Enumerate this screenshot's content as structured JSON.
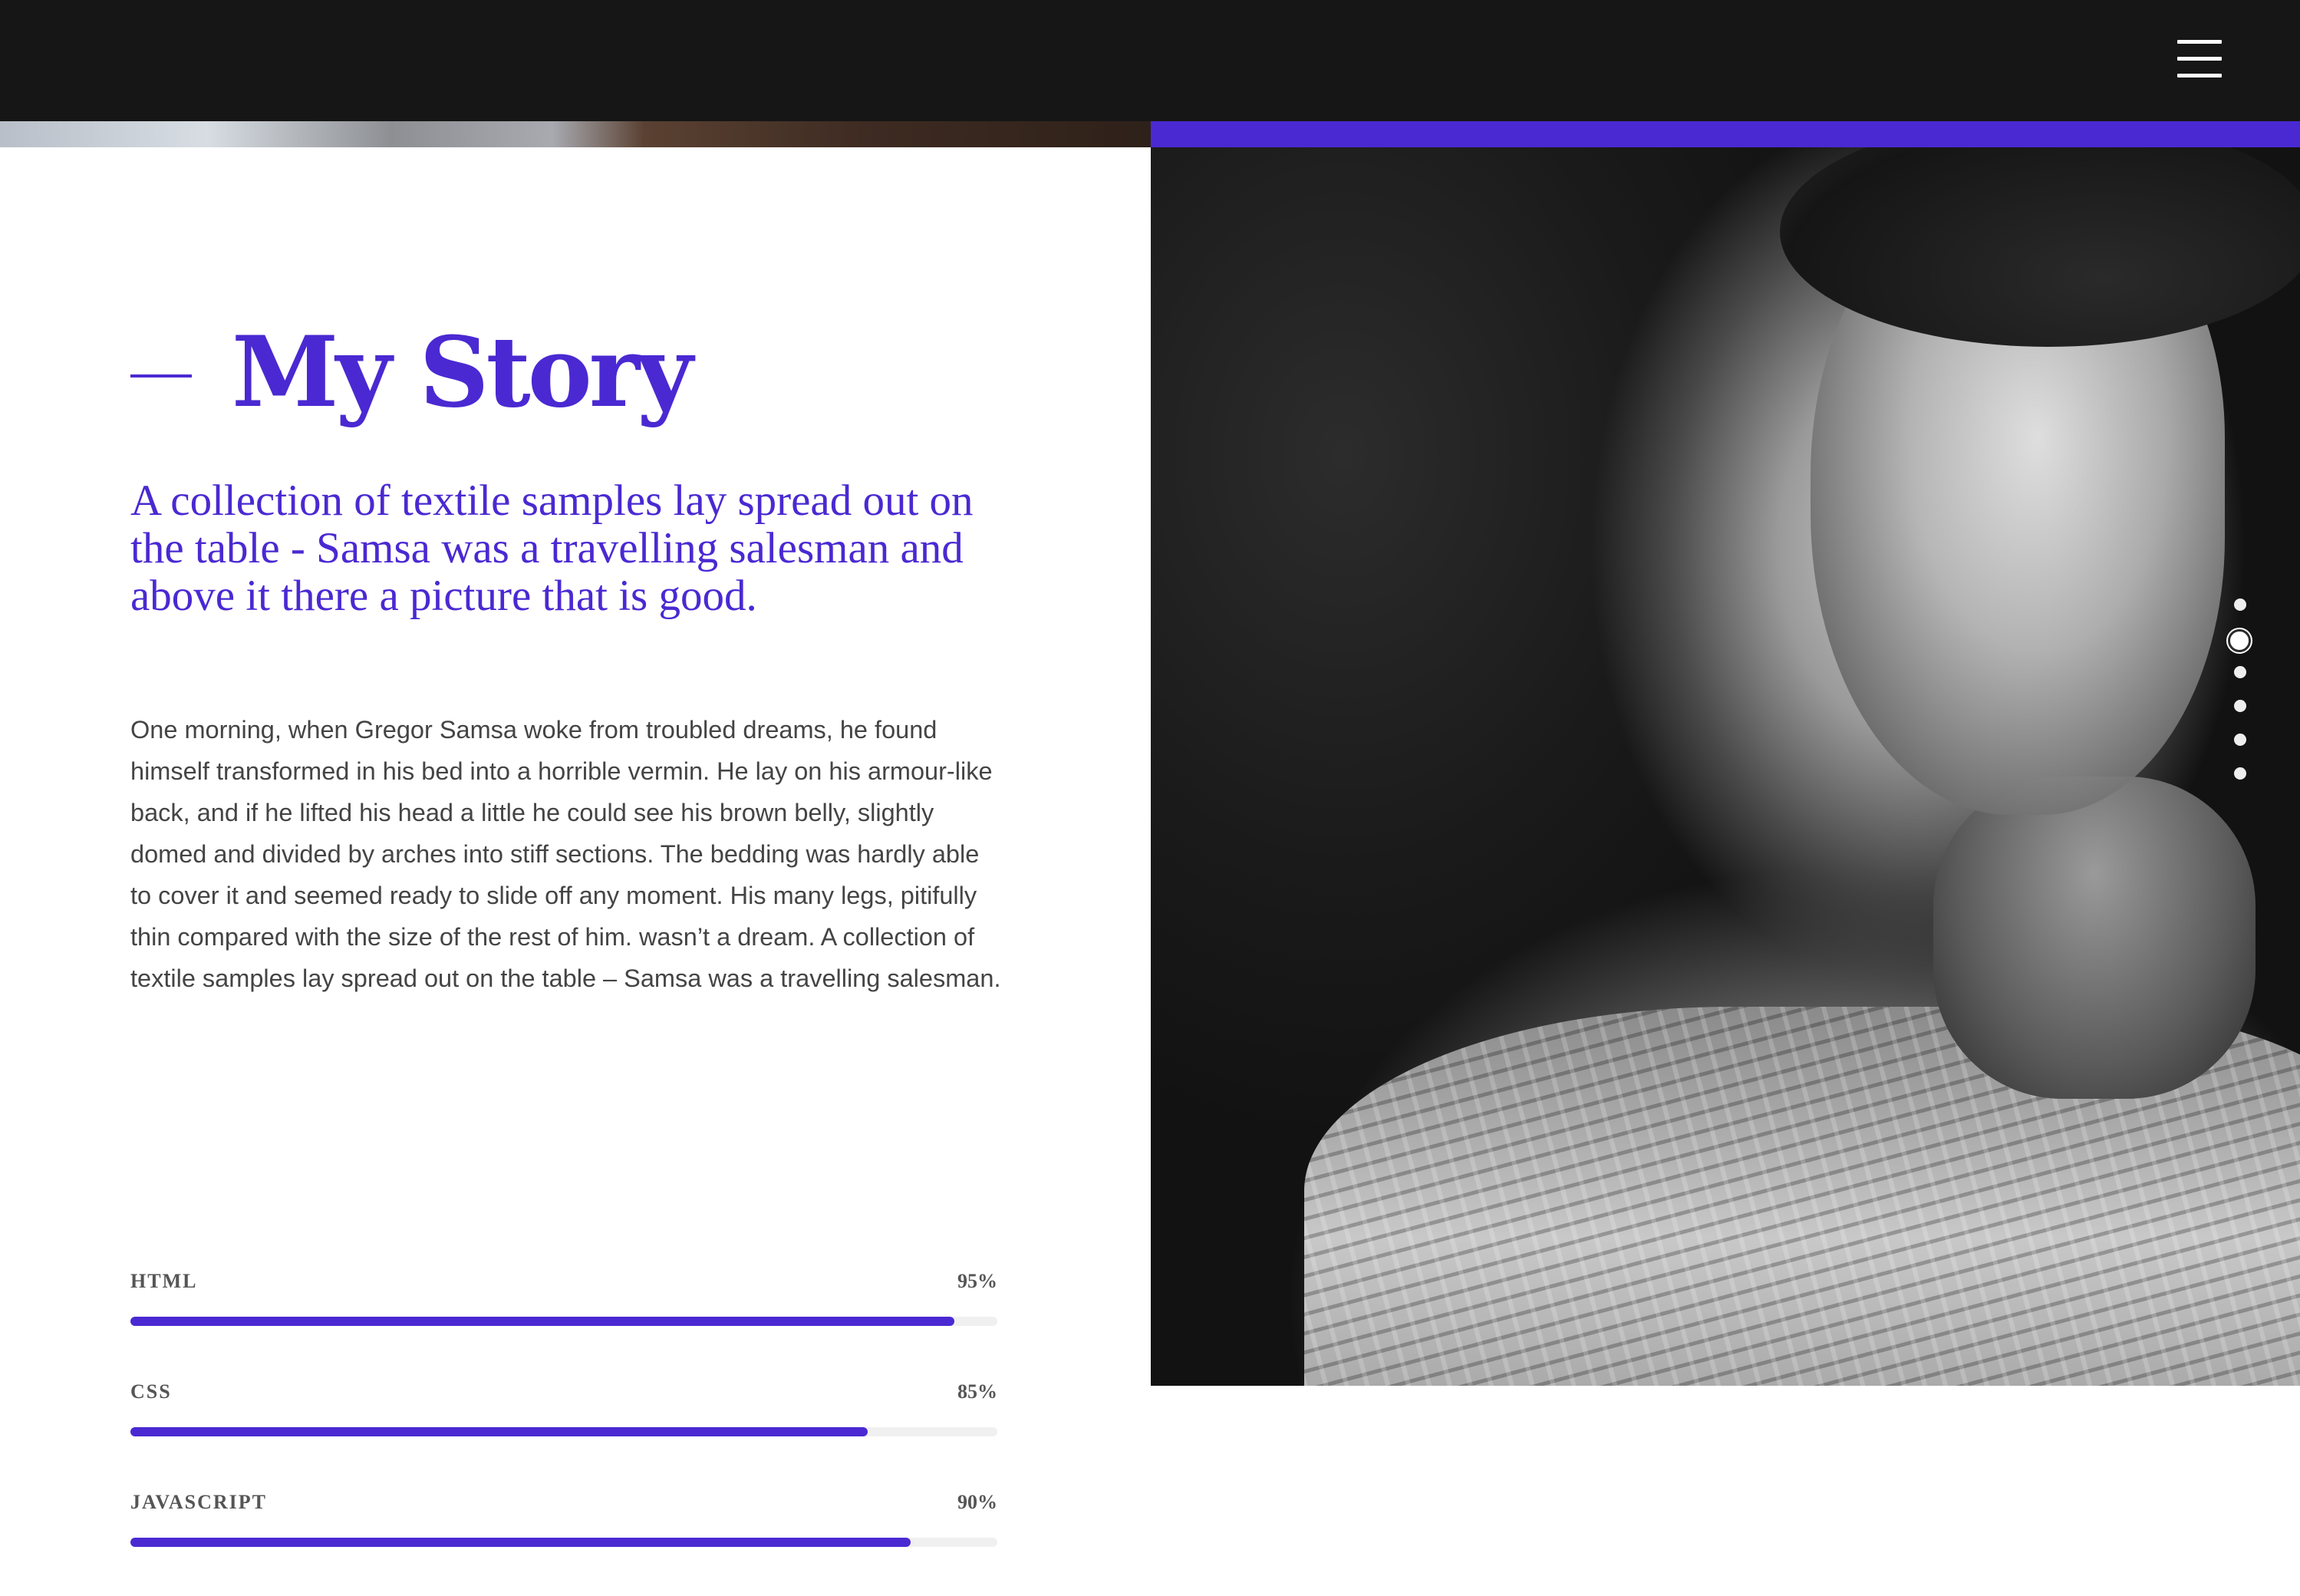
{
  "header": {
    "menu_icon": "hamburger-menu-icon"
  },
  "story": {
    "title": "My Story",
    "lead": "A collection of textile samples lay spread out on the table - Samsa was a travelling salesman and above it there a picture that is good.",
    "body": "One morning, when Gregor Samsa woke from troubled dreams, he found himself transformed in his bed into a horrible vermin. He lay on his armour-like back, and if he lifted his head a little he could see his brown belly, slightly domed and divided by arches into stiff sections. The bedding was hardly able to cover it and seemed ready to slide off any moment. His many legs, pitifully thin compared with the size of the rest of him. wasn’t a dream. A collection of textile samples lay spread out on the table – Samsa was a travelling salesman."
  },
  "skills": [
    {
      "label": "HTML",
      "percent_label": "95%",
      "value": 95
    },
    {
      "label": "CSS",
      "percent_label": "85%",
      "value": 85
    },
    {
      "label": "JAVASCRIPT",
      "percent_label": "90%",
      "value": 90
    }
  ],
  "pagination": {
    "count": 6,
    "active_index": 1
  },
  "colors": {
    "accent": "#4a29d2",
    "topbar": "#161616",
    "body_text": "#444444",
    "track": "#f0f0f0"
  },
  "photo": {
    "subject": "black-and-white portrait of a man in a plaid shirt"
  }
}
